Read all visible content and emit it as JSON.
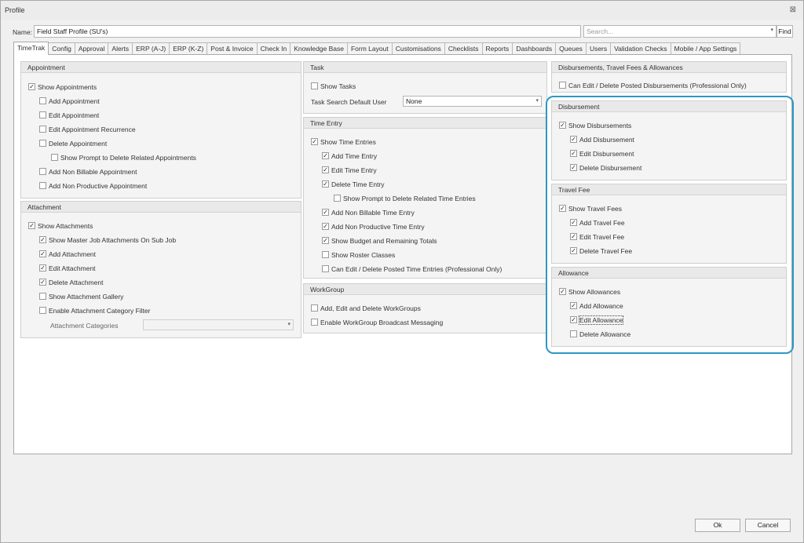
{
  "window": {
    "title": "Profile",
    "close_glyph": "⊠"
  },
  "name": {
    "label": "Name:",
    "value": "Field Staff Profile (SU's)"
  },
  "search": {
    "placeholder": "Search...",
    "find_label": "Find"
  },
  "tabs": [
    "TimeTrak",
    "Config",
    "Approval",
    "Alerts",
    "ERP (A-J)",
    "ERP (K-Z)",
    "Post & Invoice",
    "Check In",
    "Knowledge Base",
    "Form Layout",
    "Customisations",
    "Checklists",
    "Reports",
    "Dashboards",
    "Queues",
    "Users",
    "Validation Checks",
    "Mobile / App Settings"
  ],
  "appointment": {
    "title": "Appointment",
    "items": [
      {
        "label": "Show Appointments",
        "checked": true
      },
      {
        "label": "Add Appointment",
        "checked": false
      },
      {
        "label": "Edit Appointment",
        "checked": false
      },
      {
        "label": "Edit Appointment Recurrence",
        "checked": false
      },
      {
        "label": "Delete Appointment",
        "checked": false
      },
      {
        "label": "Show Prompt to Delete Related Appointments",
        "checked": false
      },
      {
        "label": "Add Non Billable Appointment",
        "checked": false
      },
      {
        "label": "Add Non Productive Appointment",
        "checked": false
      }
    ]
  },
  "attachment": {
    "title": "Attachment",
    "items": [
      {
        "label": "Show Attachments",
        "checked": true
      },
      {
        "label": "Show Master Job Attachments On Sub Job",
        "checked": true
      },
      {
        "label": "Add Attachment",
        "checked": true
      },
      {
        "label": "Edit Attachment",
        "checked": true
      },
      {
        "label": "Delete Attachment",
        "checked": true
      },
      {
        "label": "Show Attachment Gallery",
        "checked": false
      },
      {
        "label": "Enable Attachment Category Filter",
        "checked": false
      }
    ],
    "categories_label": "Attachment Categories",
    "categories_value": ""
  },
  "task": {
    "title": "Task",
    "show_tasks": {
      "label": "Show Tasks",
      "checked": false
    },
    "default_user_label": "Task Search Default User",
    "default_user_value": "None"
  },
  "time_entry": {
    "title": "Time Entry",
    "items": [
      {
        "label": "Show Time Entries",
        "checked": true
      },
      {
        "label": "Add Time Entry",
        "checked": true
      },
      {
        "label": "Edit Time Entry",
        "checked": true
      },
      {
        "label": "Delete Time Entry",
        "checked": true
      },
      {
        "label": "Show Prompt to Delete Related Time Entries",
        "checked": false
      },
      {
        "label": "Add Non Billable Time Entry",
        "checked": true
      },
      {
        "label": "Add Non Productive Time Entry",
        "checked": true
      },
      {
        "label": "Show Budget and Remaining Totals",
        "checked": true
      },
      {
        "label": "Show Roster Classes",
        "checked": false
      },
      {
        "label": "Can Edit / Delete Posted Time Entries (Professional Only)",
        "checked": false
      }
    ]
  },
  "workgroup": {
    "title": "WorkGroup",
    "items": [
      {
        "label": "Add, Edit and Delete WorkGroups",
        "checked": false
      },
      {
        "label": "Enable WorkGroup Broadcast Messaging",
        "checked": false
      }
    ]
  },
  "dtfa": {
    "title": "Disbursements, Travel Fees & Allowances",
    "items": [
      {
        "label": "Can Edit / Delete Posted Disbursements (Professional Only)",
        "checked": false
      }
    ]
  },
  "disbursement": {
    "title": "Disbursement",
    "items": [
      {
        "label": "Show Disbursements",
        "checked": true
      },
      {
        "label": "Add Disbursement",
        "checked": true
      },
      {
        "label": "Edit Disbursement",
        "checked": true
      },
      {
        "label": "Delete Disbursement",
        "checked": true
      }
    ]
  },
  "travel_fee": {
    "title": "Travel Fee",
    "items": [
      {
        "label": "Show Travel Fees",
        "checked": true
      },
      {
        "label": "Add Travel Fee",
        "checked": true
      },
      {
        "label": "Edit Travel Fee",
        "checked": true
      },
      {
        "label": "Delete Travel Fee",
        "checked": true
      }
    ]
  },
  "allowance": {
    "title": "Allowance",
    "items": [
      {
        "label": "Show Allowances",
        "checked": true
      },
      {
        "label": "Add Allowance",
        "checked": true
      },
      {
        "label": "Edit Allowance",
        "checked": true
      },
      {
        "label": "Delete Allowance",
        "checked": false
      }
    ]
  },
  "buttons": {
    "ok": "Ok",
    "cancel": "Cancel"
  },
  "colors": {
    "highlight": "#2e97c4"
  },
  "icons": {
    "checked": "✓",
    "dropdown": "▾"
  }
}
